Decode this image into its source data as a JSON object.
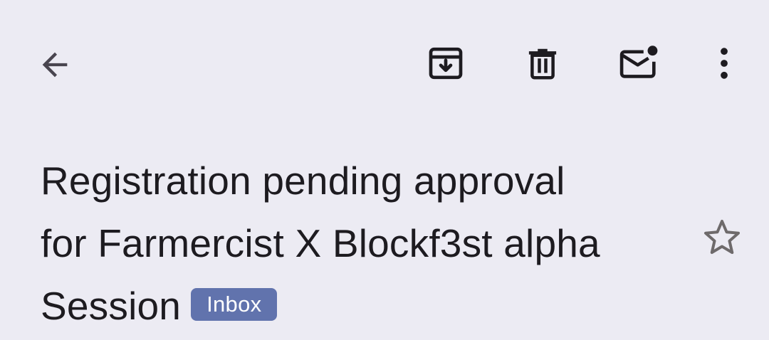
{
  "toolbar": {
    "back_icon": "arrow-back-icon",
    "archive_icon": "archive-icon",
    "delete_icon": "trash-icon",
    "mark_unread_icon": "mark-unread-icon",
    "more_icon": "more-vert-icon"
  },
  "email": {
    "subject_lines": [
      "Registration pending approval",
      "for Farmercist X Blockf3st alpha",
      "Session"
    ],
    "label_chip": "Inbox",
    "star_icon": "star-outline-icon"
  },
  "colors": {
    "background": "#ecebf3",
    "text": "#1d1b20",
    "chip_background": "#6173ad",
    "chip_text": "#ffffff",
    "icon": "#1d1b20",
    "back_icon": "#49454f",
    "star_outline": "#6e6a6b"
  }
}
